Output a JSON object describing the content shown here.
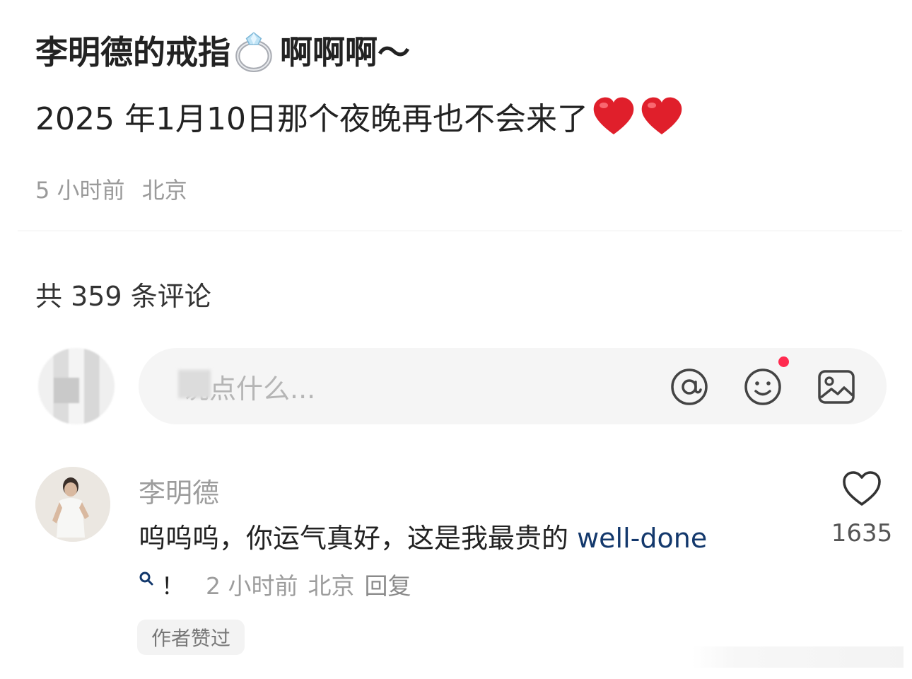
{
  "post": {
    "title_prefix": "李明德的戒指",
    "title_suffix": "啊啊啊～",
    "body": "2025 年1月10日那个夜晚再也不会来了",
    "time": "5 小时前",
    "location": "北京"
  },
  "comments_section": {
    "count_label": "共 359 条评论"
  },
  "composer": {
    "placeholder": "说点什么..."
  },
  "comment": {
    "username": "李明德",
    "text": "呜呜呜，你运气真好，这是我最贵的 ",
    "link_text": "well-done",
    "trailing": "！",
    "time": "2 小时前",
    "location": "北京",
    "reply_label": "回复",
    "author_liked_label": "作者赞过",
    "like_count": "1635"
  },
  "icons": {
    "ring": "ring-emoji",
    "heart": "red-heart-emoji",
    "at": "at-icon",
    "emoji": "smiley-icon",
    "image": "image-icon",
    "like": "heart-outline-icon"
  },
  "colors": {
    "link": "#13386c",
    "notification_dot": "#ff2a4f",
    "secondary_text": "#9c9c9c"
  }
}
